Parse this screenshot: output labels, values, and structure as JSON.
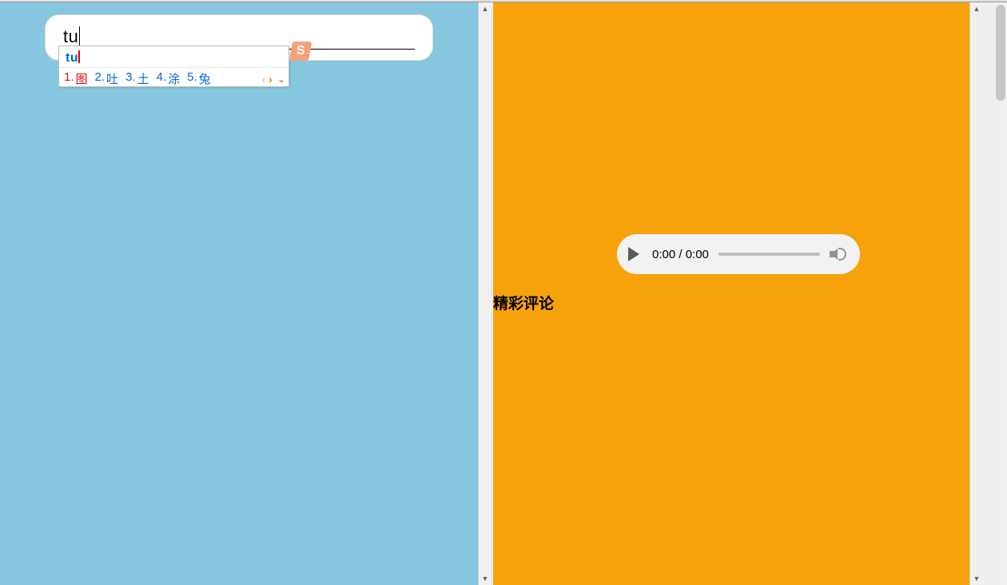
{
  "left": {
    "search": {
      "value": "tu"
    }
  },
  "ime": {
    "composition": "tu",
    "candidates": [
      {
        "num": "1.",
        "word": "图"
      },
      {
        "num": "2.",
        "word": "吐"
      },
      {
        "num": "3.",
        "word": "土"
      },
      {
        "num": "4.",
        "word": "涂"
      },
      {
        "num": "5.",
        "word": "兔"
      }
    ],
    "logo_letter": "S"
  },
  "right": {
    "audio": {
      "time_display": "0:00 / 0:00"
    },
    "comments_heading": "精彩评论"
  }
}
